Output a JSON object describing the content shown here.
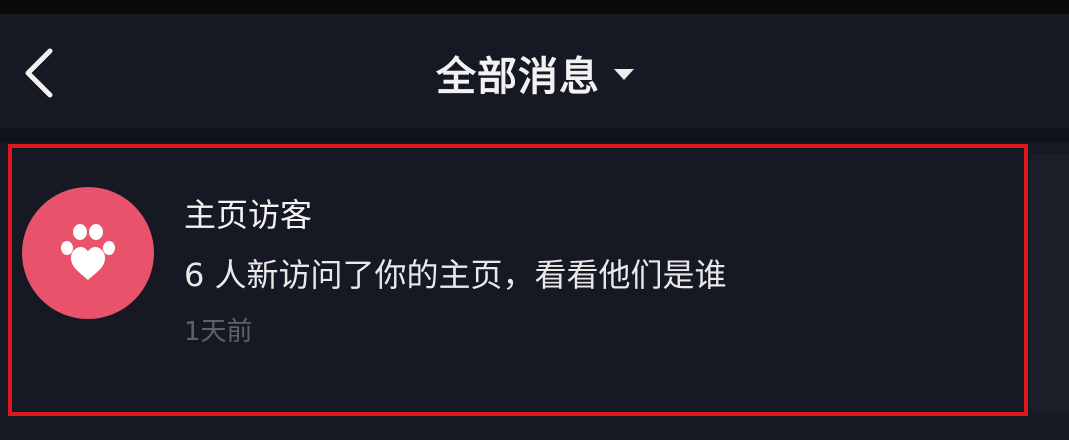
{
  "header": {
    "title": "全部消息",
    "back_icon": "chevron-left-icon",
    "dropdown_icon": "caret-down-icon"
  },
  "messages": [
    {
      "icon": "paw-heart-icon",
      "icon_bg_color": "#e8526a",
      "title": "主页访客",
      "subtitle": "6 人新访问了你的主页，看看他们是谁",
      "time": "1天前",
      "highlight_color": "#e0171d"
    }
  ],
  "colors": {
    "background": "#161823",
    "text": "#f3f3f3",
    "muted_text": "#5e606b"
  }
}
